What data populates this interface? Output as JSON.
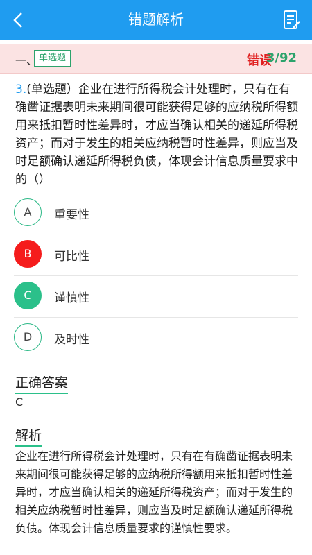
{
  "header": {
    "title": "错题解析",
    "back_icon": "chevron-left-icon",
    "notes_icon": "notes-icon",
    "bg": "#1f9cf0"
  },
  "section": {
    "number": "一、",
    "type_badge": "单选题",
    "status": "错误",
    "progress": "3/92"
  },
  "question": {
    "number": "3.",
    "text": "(单选题）企业在进行所得税会计处理时，只有在有确凿证据表明未来期间很可能获得足够的应纳税所得额用来抵扣暂时性差异时，才应当确认相关的递延所得税资产；而对于发生的相关应纳税暂时性差异，则应当及时足额确认递延所得税负债，体现会计信息质量要求中的（）"
  },
  "options": [
    {
      "letter": "A",
      "text": "重要性",
      "state": "normal"
    },
    {
      "letter": "B",
      "text": "可比性",
      "state": "wrong"
    },
    {
      "letter": "C",
      "text": "谨慎性",
      "state": "correct"
    },
    {
      "letter": "D",
      "text": "及时性",
      "state": "normal"
    }
  ],
  "answer": {
    "heading": "正确答案",
    "value": "C"
  },
  "analysis": {
    "heading": "解析",
    "text": "企业在进行所得税会计处理时，只有在有确凿证据表明未来期间很可能获得足够的应纳税所得额用来抵扣暂时性差异时，才应当确认相关的递延所得税资产；而对于发生的相关应纳税暂时性差异，则应当及时足额确认递延所得税负债。体现会计信息质量要求的谨慎性要求。"
  },
  "colors": {
    "wrong": "#f51c1c",
    "correct": "#2bc08a",
    "accent": "#1f9cf0"
  }
}
